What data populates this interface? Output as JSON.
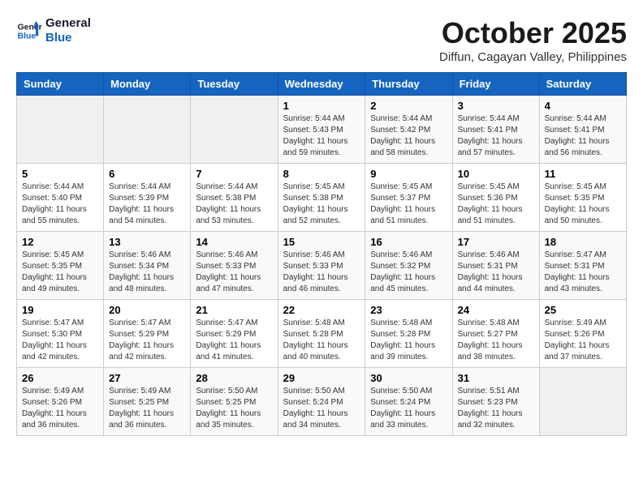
{
  "logo": {
    "line1": "General",
    "line2": "Blue"
  },
  "title": "October 2025",
  "subtitle": "Diffun, Cagayan Valley, Philippines",
  "weekdays": [
    "Sunday",
    "Monday",
    "Tuesday",
    "Wednesday",
    "Thursday",
    "Friday",
    "Saturday"
  ],
  "weeks": [
    [
      {
        "day": "",
        "sunrise": "",
        "sunset": "",
        "daylight": ""
      },
      {
        "day": "",
        "sunrise": "",
        "sunset": "",
        "daylight": ""
      },
      {
        "day": "",
        "sunrise": "",
        "sunset": "",
        "daylight": ""
      },
      {
        "day": "1",
        "sunrise": "Sunrise: 5:44 AM",
        "sunset": "Sunset: 5:43 PM",
        "daylight": "Daylight: 11 hours and 59 minutes."
      },
      {
        "day": "2",
        "sunrise": "Sunrise: 5:44 AM",
        "sunset": "Sunset: 5:42 PM",
        "daylight": "Daylight: 11 hours and 58 minutes."
      },
      {
        "day": "3",
        "sunrise": "Sunrise: 5:44 AM",
        "sunset": "Sunset: 5:41 PM",
        "daylight": "Daylight: 11 hours and 57 minutes."
      },
      {
        "day": "4",
        "sunrise": "Sunrise: 5:44 AM",
        "sunset": "Sunset: 5:41 PM",
        "daylight": "Daylight: 11 hours and 56 minutes."
      }
    ],
    [
      {
        "day": "5",
        "sunrise": "Sunrise: 5:44 AM",
        "sunset": "Sunset: 5:40 PM",
        "daylight": "Daylight: 11 hours and 55 minutes."
      },
      {
        "day": "6",
        "sunrise": "Sunrise: 5:44 AM",
        "sunset": "Sunset: 5:39 PM",
        "daylight": "Daylight: 11 hours and 54 minutes."
      },
      {
        "day": "7",
        "sunrise": "Sunrise: 5:44 AM",
        "sunset": "Sunset: 5:38 PM",
        "daylight": "Daylight: 11 hours and 53 minutes."
      },
      {
        "day": "8",
        "sunrise": "Sunrise: 5:45 AM",
        "sunset": "Sunset: 5:38 PM",
        "daylight": "Daylight: 11 hours and 52 minutes."
      },
      {
        "day": "9",
        "sunrise": "Sunrise: 5:45 AM",
        "sunset": "Sunset: 5:37 PM",
        "daylight": "Daylight: 11 hours and 51 minutes."
      },
      {
        "day": "10",
        "sunrise": "Sunrise: 5:45 AM",
        "sunset": "Sunset: 5:36 PM",
        "daylight": "Daylight: 11 hours and 51 minutes."
      },
      {
        "day": "11",
        "sunrise": "Sunrise: 5:45 AM",
        "sunset": "Sunset: 5:35 PM",
        "daylight": "Daylight: 11 hours and 50 minutes."
      }
    ],
    [
      {
        "day": "12",
        "sunrise": "Sunrise: 5:45 AM",
        "sunset": "Sunset: 5:35 PM",
        "daylight": "Daylight: 11 hours and 49 minutes."
      },
      {
        "day": "13",
        "sunrise": "Sunrise: 5:46 AM",
        "sunset": "Sunset: 5:34 PM",
        "daylight": "Daylight: 11 hours and 48 minutes."
      },
      {
        "day": "14",
        "sunrise": "Sunrise: 5:46 AM",
        "sunset": "Sunset: 5:33 PM",
        "daylight": "Daylight: 11 hours and 47 minutes."
      },
      {
        "day": "15",
        "sunrise": "Sunrise: 5:46 AM",
        "sunset": "Sunset: 5:33 PM",
        "daylight": "Daylight: 11 hours and 46 minutes."
      },
      {
        "day": "16",
        "sunrise": "Sunrise: 5:46 AM",
        "sunset": "Sunset: 5:32 PM",
        "daylight": "Daylight: 11 hours and 45 minutes."
      },
      {
        "day": "17",
        "sunrise": "Sunrise: 5:46 AM",
        "sunset": "Sunset: 5:31 PM",
        "daylight": "Daylight: 11 hours and 44 minutes."
      },
      {
        "day": "18",
        "sunrise": "Sunrise: 5:47 AM",
        "sunset": "Sunset: 5:31 PM",
        "daylight": "Daylight: 11 hours and 43 minutes."
      }
    ],
    [
      {
        "day": "19",
        "sunrise": "Sunrise: 5:47 AM",
        "sunset": "Sunset: 5:30 PM",
        "daylight": "Daylight: 11 hours and 42 minutes."
      },
      {
        "day": "20",
        "sunrise": "Sunrise: 5:47 AM",
        "sunset": "Sunset: 5:29 PM",
        "daylight": "Daylight: 11 hours and 42 minutes."
      },
      {
        "day": "21",
        "sunrise": "Sunrise: 5:47 AM",
        "sunset": "Sunset: 5:29 PM",
        "daylight": "Daylight: 11 hours and 41 minutes."
      },
      {
        "day": "22",
        "sunrise": "Sunrise: 5:48 AM",
        "sunset": "Sunset: 5:28 PM",
        "daylight": "Daylight: 11 hours and 40 minutes."
      },
      {
        "day": "23",
        "sunrise": "Sunrise: 5:48 AM",
        "sunset": "Sunset: 5:28 PM",
        "daylight": "Daylight: 11 hours and 39 minutes."
      },
      {
        "day": "24",
        "sunrise": "Sunrise: 5:48 AM",
        "sunset": "Sunset: 5:27 PM",
        "daylight": "Daylight: 11 hours and 38 minutes."
      },
      {
        "day": "25",
        "sunrise": "Sunrise: 5:49 AM",
        "sunset": "Sunset: 5:26 PM",
        "daylight": "Daylight: 11 hours and 37 minutes."
      }
    ],
    [
      {
        "day": "26",
        "sunrise": "Sunrise: 5:49 AM",
        "sunset": "Sunset: 5:26 PM",
        "daylight": "Daylight: 11 hours and 36 minutes."
      },
      {
        "day": "27",
        "sunrise": "Sunrise: 5:49 AM",
        "sunset": "Sunset: 5:25 PM",
        "daylight": "Daylight: 11 hours and 36 minutes."
      },
      {
        "day": "28",
        "sunrise": "Sunrise: 5:50 AM",
        "sunset": "Sunset: 5:25 PM",
        "daylight": "Daylight: 11 hours and 35 minutes."
      },
      {
        "day": "29",
        "sunrise": "Sunrise: 5:50 AM",
        "sunset": "Sunset: 5:24 PM",
        "daylight": "Daylight: 11 hours and 34 minutes."
      },
      {
        "day": "30",
        "sunrise": "Sunrise: 5:50 AM",
        "sunset": "Sunset: 5:24 PM",
        "daylight": "Daylight: 11 hours and 33 minutes."
      },
      {
        "day": "31",
        "sunrise": "Sunrise: 5:51 AM",
        "sunset": "Sunset: 5:23 PM",
        "daylight": "Daylight: 11 hours and 32 minutes."
      },
      {
        "day": "",
        "sunrise": "",
        "sunset": "",
        "daylight": ""
      }
    ]
  ]
}
